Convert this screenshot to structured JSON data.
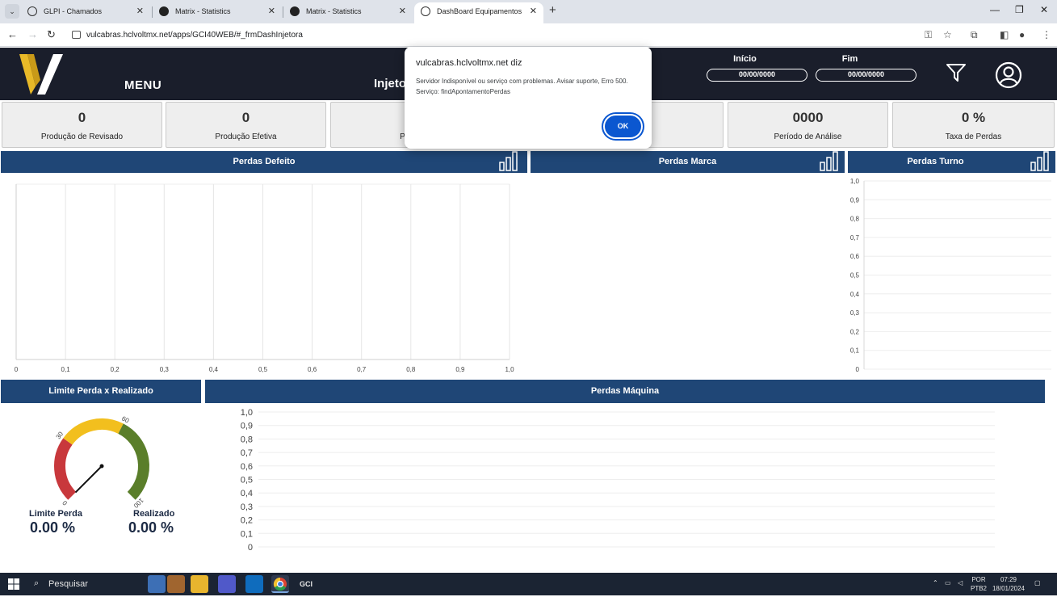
{
  "browser": {
    "tabs": [
      {
        "title": "GLPI - Chamados"
      },
      {
        "title": "Matrix - Statistics"
      },
      {
        "title": "Matrix - Statistics"
      },
      {
        "title": "DashBoard Equipamentos"
      }
    ],
    "url": "vulcabras.hclvoltmx.net/apps/GCI40WEB/#_frmDashInjetora"
  },
  "header": {
    "menu_label": "MENU",
    "title": "Injeto",
    "start_label": "Início",
    "end_label": "Fim",
    "start_date": "00/00/0000",
    "end_date": "00/00/0000",
    "logo_colors": [
      "#e8b928",
      "#ffffff"
    ]
  },
  "kpis": [
    {
      "value": "0",
      "label": "Produção de Revisado"
    },
    {
      "value": "0",
      "label": "Produção Efetiva"
    },
    {
      "value": "",
      "label": "Perda"
    },
    {
      "value": "",
      "label": ""
    },
    {
      "value": "0000",
      "label": "Período de Análise"
    },
    {
      "value": "0 %",
      "label": "Taxa de Perdas"
    }
  ],
  "panels": {
    "defeito": "Perdas Defeito",
    "marca": "Perdas Marca",
    "turno": "Perdas Turno",
    "limite": "Limite Perda x Realizado",
    "maquina": "Perdas Máquina"
  },
  "chart_data": [
    {
      "type": "bar",
      "orientation": "horizontal",
      "panel": "Perdas Defeito",
      "categories": [],
      "values": [],
      "x_ticks": [
        "0",
        "0,1",
        "0,2",
        "0,3",
        "0,4",
        "0,5",
        "0,6",
        "0,7",
        "0,8",
        "0,9",
        "1,0"
      ],
      "xlim": [
        0,
        1
      ],
      "grid": true
    },
    {
      "type": "bar",
      "panel": "Perdas Marca",
      "categories": [],
      "values": []
    },
    {
      "type": "bar",
      "panel": "Perdas Turno",
      "categories": [],
      "values": [],
      "y_ticks": [
        "0",
        "0,1",
        "0,2",
        "0,3",
        "0,4",
        "0,5",
        "0,6",
        "0,7",
        "0,8",
        "0,9",
        "1,0"
      ],
      "ylim": [
        0,
        1
      ],
      "grid": true
    },
    {
      "type": "bar",
      "panel": "Perdas Máquina",
      "categories": [],
      "values": [],
      "y_ticks": [
        "0",
        "0,1",
        "0,2",
        "0,3",
        "0,4",
        "0,5",
        "0,6",
        "0,7",
        "0,8",
        "0,9",
        "1,0"
      ],
      "ylim": [
        0,
        1
      ],
      "grid": true
    }
  ],
  "gauge": {
    "range": [
      0,
      100
    ],
    "ticks": [
      "0",
      "30",
      "60",
      "100"
    ],
    "zones": [
      {
        "from": 0,
        "to": 30,
        "color": "#c8383c"
      },
      {
        "from": 30,
        "to": 60,
        "color": "#f2bf1e"
      },
      {
        "from": 60,
        "to": 100,
        "color": "#5a7e2a"
      }
    ],
    "needle_value": 0,
    "limit_label": "Limite Perda",
    "limit_value": "0.00 %",
    "realized_label": "Realizado",
    "realized_value": "0.00 %"
  },
  "dialog": {
    "title": "vulcabras.hclvoltmx.net diz",
    "message_line1": "Servidor Indisponível ou serviço com problemas. Avisar suporte, Erro 500.",
    "message_line2": "Serviço: findApontamentoPerdas",
    "ok_label": "OK"
  },
  "taskbar": {
    "search_placeholder": "Pesquisar",
    "lang1": "POR",
    "lang2": "PTB2",
    "time": "07:29",
    "date": "18/01/2024"
  }
}
